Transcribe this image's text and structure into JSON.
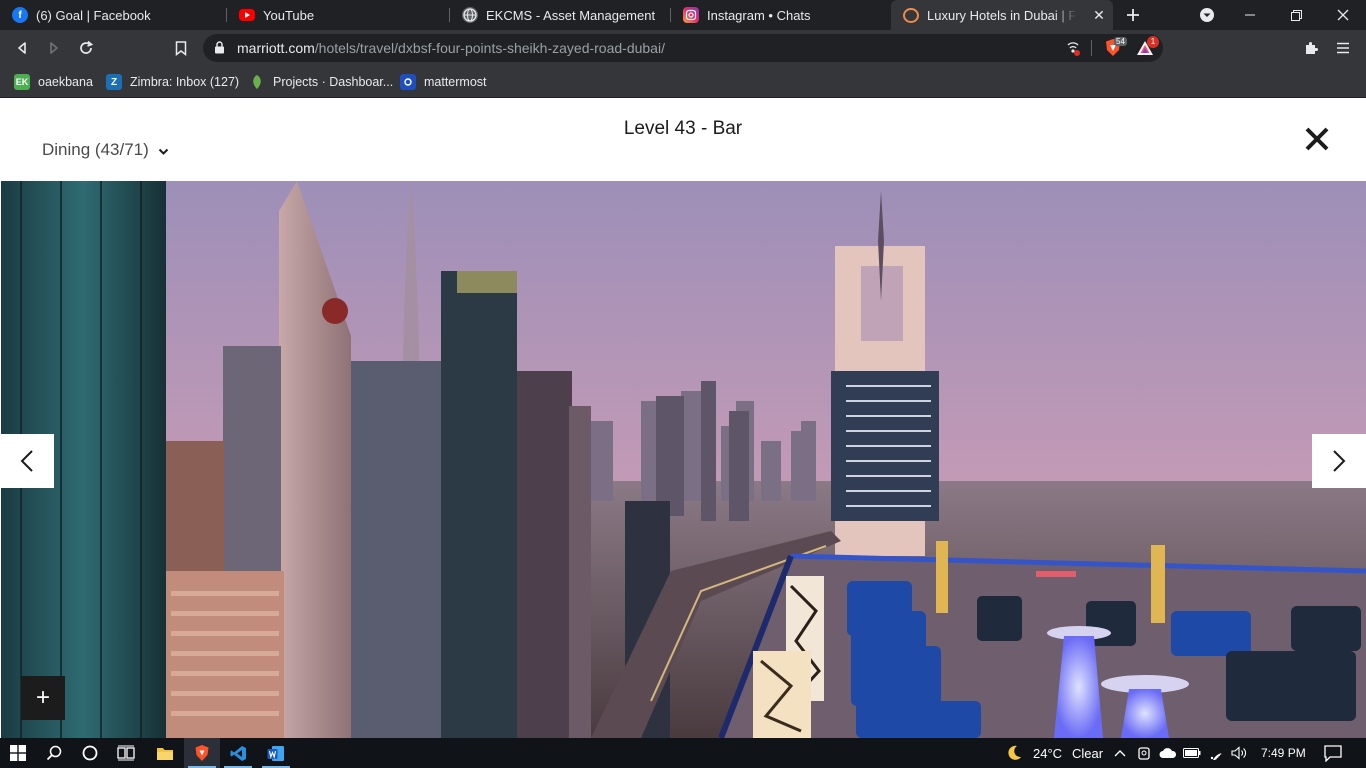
{
  "browser": {
    "tabs": [
      {
        "title": "(6) Goal | Facebook",
        "icon": "facebook-icon"
      },
      {
        "title": "YouTube",
        "icon": "youtube-icon"
      },
      {
        "title": "EKCMS - Asset Management",
        "icon": "globe-icon"
      },
      {
        "title": "Instagram • Chats",
        "icon": "instagram-icon"
      },
      {
        "title": "Luxury Hotels in Dubai | Four Points",
        "icon": "marriott-icon",
        "active": true
      }
    ],
    "url_host": "marriott.com",
    "url_path": "/hotels/travel/dxbsf-four-points-sheikh-zayed-road-dubai/",
    "brave_shield_count": "54",
    "brave_rewards_count": "1",
    "bookmarks": [
      {
        "label": "oaekbana",
        "badge": "EK"
      },
      {
        "label": "Zimbra: Inbox (127)",
        "badge": "Z"
      },
      {
        "label": "Projects · Dashboar...",
        "badge": ""
      },
      {
        "label": "mattermost",
        "badge": ""
      }
    ]
  },
  "gallery": {
    "title": "Level 43 - Bar",
    "category": "Dining (43/71)",
    "zoom_label": "+"
  },
  "taskbar": {
    "temperature": "24°C",
    "weather": "Clear",
    "time": "7:49 PM"
  },
  "colors": {
    "chrome_dark": "#202124",
    "chrome_mid": "#35363a",
    "taskbar": "#101318",
    "sky_top": "#9d8fb8",
    "sky_bottom": "#cfa5b7",
    "accent_blue": "#2a5fc9"
  }
}
